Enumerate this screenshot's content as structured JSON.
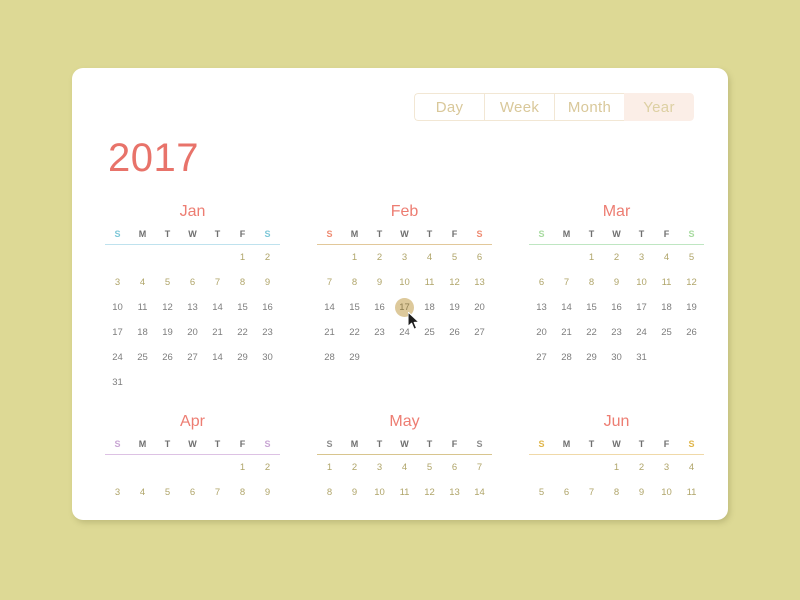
{
  "background_color": "#ddd995",
  "card": {
    "background_color": "#ffffff"
  },
  "tabs": {
    "items": [
      {
        "label": "Day",
        "active": false
      },
      {
        "label": "Week",
        "active": false
      },
      {
        "label": "Month",
        "active": false
      },
      {
        "label": "Year",
        "active": true
      }
    ],
    "active_color": "#fbeee7",
    "text_color": "#d9c89a"
  },
  "header": {
    "year": "2017",
    "year_color": "#e8736a"
  },
  "weekday_labels": [
    "S",
    "M",
    "T",
    "W",
    "T",
    "F",
    "S"
  ],
  "selected_day": {
    "month": "Feb",
    "day": "17",
    "highlight_color": "#ddc99b"
  },
  "months": [
    {
      "name": "Jan",
      "accent_color": "#7ec8d8",
      "rule_color": "#bfe2ee",
      "weeks": [
        [
          "",
          "",
          "",
          "",
          "",
          "1",
          "2"
        ],
        [
          "3",
          "4",
          "5",
          "6",
          "7",
          "8",
          "9"
        ],
        [
          "10",
          "11",
          "12",
          "13",
          "14",
          "15",
          "16"
        ],
        [
          "17",
          "18",
          "19",
          "20",
          "21",
          "22",
          "23"
        ],
        [
          "24",
          "25",
          "26",
          "27",
          "14",
          "29",
          "30"
        ],
        [
          "31",
          "",
          "",
          "",
          "",
          "",
          ""
        ]
      ]
    },
    {
      "name": "Feb",
      "accent_color": "#ef8b72",
      "rule_color": "#e2c89a",
      "weeks": [
        [
          "",
          "1",
          "2",
          "3",
          "4",
          "5",
          "6"
        ],
        [
          "7",
          "8",
          "9",
          "10",
          "11",
          "12",
          "13"
        ],
        [
          "14",
          "15",
          "16",
          "17",
          "18",
          "19",
          "20"
        ],
        [
          "21",
          "22",
          "23",
          "24",
          "25",
          "26",
          "27"
        ],
        [
          "28",
          "29",
          "",
          "",
          "",
          "",
          ""
        ]
      ]
    },
    {
      "name": "Mar",
      "accent_color": "#a8dba0",
      "rule_color": "#bfe6c2",
      "weeks": [
        [
          "",
          "",
          "1",
          "2",
          "3",
          "4",
          "5"
        ],
        [
          "6",
          "7",
          "8",
          "9",
          "10",
          "11",
          "12"
        ],
        [
          "13",
          "14",
          "15",
          "16",
          "17",
          "18",
          "19"
        ],
        [
          "20",
          "21",
          "22",
          "23",
          "24",
          "25",
          "26"
        ],
        [
          "27",
          "28",
          "29",
          "30",
          "31",
          "",
          ""
        ]
      ]
    },
    {
      "name": "Apr",
      "accent_color": "#c9a6d4",
      "rule_color": "#ddc2e4",
      "weeks": [
        [
          "",
          "",
          "",
          "",
          "",
          "1",
          "2"
        ],
        [
          "3",
          "4",
          "5",
          "6",
          "7",
          "8",
          "9"
        ]
      ]
    },
    {
      "name": "May",
      "accent_color": "#8d8d8d",
      "rule_color": "#d8c58e",
      "weeks": [
        [
          "1",
          "2",
          "3",
          "4",
          "5",
          "6",
          "7"
        ],
        [
          "8",
          "9",
          "10",
          "11",
          "12",
          "13",
          "14"
        ]
      ]
    },
    {
      "name": "Jun",
      "accent_color": "#e0b64a",
      "rule_color": "#f0d9a8",
      "weeks": [
        [
          "",
          "",
          "",
          "1",
          "2",
          "3",
          "4"
        ],
        [
          "5",
          "6",
          "7",
          "8",
          "9",
          "10",
          "11"
        ]
      ]
    }
  ]
}
